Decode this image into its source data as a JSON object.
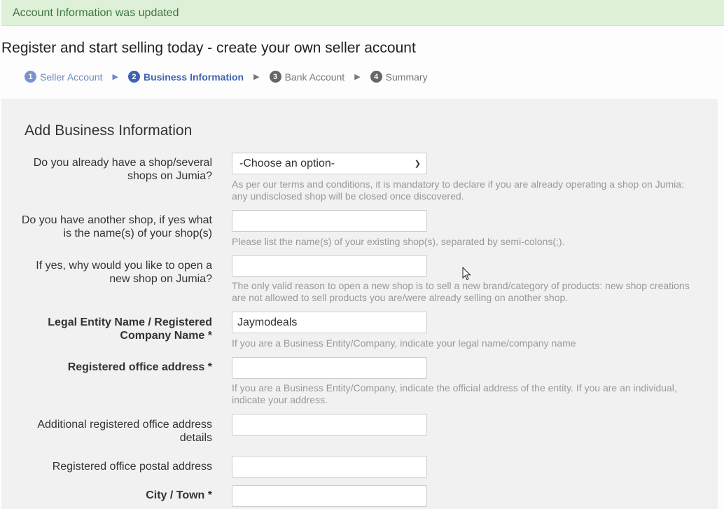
{
  "alert": {
    "message": "Account Information was updated"
  },
  "page": {
    "title": "Register and start selling today - create your own seller account"
  },
  "steps": [
    {
      "number": "1",
      "label": "Seller Account",
      "state": "done"
    },
    {
      "number": "2",
      "label": "Business Information",
      "state": "active"
    },
    {
      "number": "3",
      "label": "Bank Account",
      "state": "todo"
    },
    {
      "number": "4",
      "label": "Summary",
      "state": "todo"
    }
  ],
  "step_separator_icon": "triangle-right-icon",
  "form": {
    "title": "Add Business Information",
    "fields": [
      {
        "label": "Do you already have a shop/several shops on Jumia?",
        "type": "select",
        "value": "-Choose an option-",
        "help": "As per our terms and conditions, it is mandatory to declare if you are already operating a shop on Jumia: any undisclosed shop will be closed once discovered."
      },
      {
        "label": "Do you have another shop, if yes what is the name(s) of your shop(s)",
        "type": "text",
        "value": "",
        "help": "Please list the name(s) of your existing shop(s), separated by semi-colons(;)."
      },
      {
        "label": "If yes, why would you like to open a new shop on Jumia?",
        "type": "text",
        "value": "",
        "help": "The only valid reason to open a new shop is to sell a new brand/category of products: new shop creations are not allowed to sell products you are/were already selling on another shop."
      },
      {
        "label": "Legal Entity Name / Registered Company Name *",
        "type": "text",
        "required": true,
        "value": "Jaymodeals",
        "help": "If you are a Business Entity/Company, indicate your legal name/company name"
      },
      {
        "label": "Registered office address *",
        "type": "text",
        "required": true,
        "value": "",
        "help": "If you are a Business Entity/Company, indicate the official address of the entity. If you are an individual, indicate your address."
      },
      {
        "label": "Additional registered office address details",
        "type": "text",
        "value": ""
      },
      {
        "label": "Registered office postal address",
        "type": "text",
        "value": ""
      },
      {
        "label": "City / Town *",
        "type": "text",
        "required": true,
        "value": ""
      }
    ]
  },
  "colors": {
    "alert_bg": "#dff0d8",
    "alert_text": "#3c763d",
    "step_active": "#3f62b4",
    "step_done": "#7a93cf",
    "step_todo": "#666666",
    "panel_bg": "#f1f1f1",
    "help_text": "#999999"
  }
}
